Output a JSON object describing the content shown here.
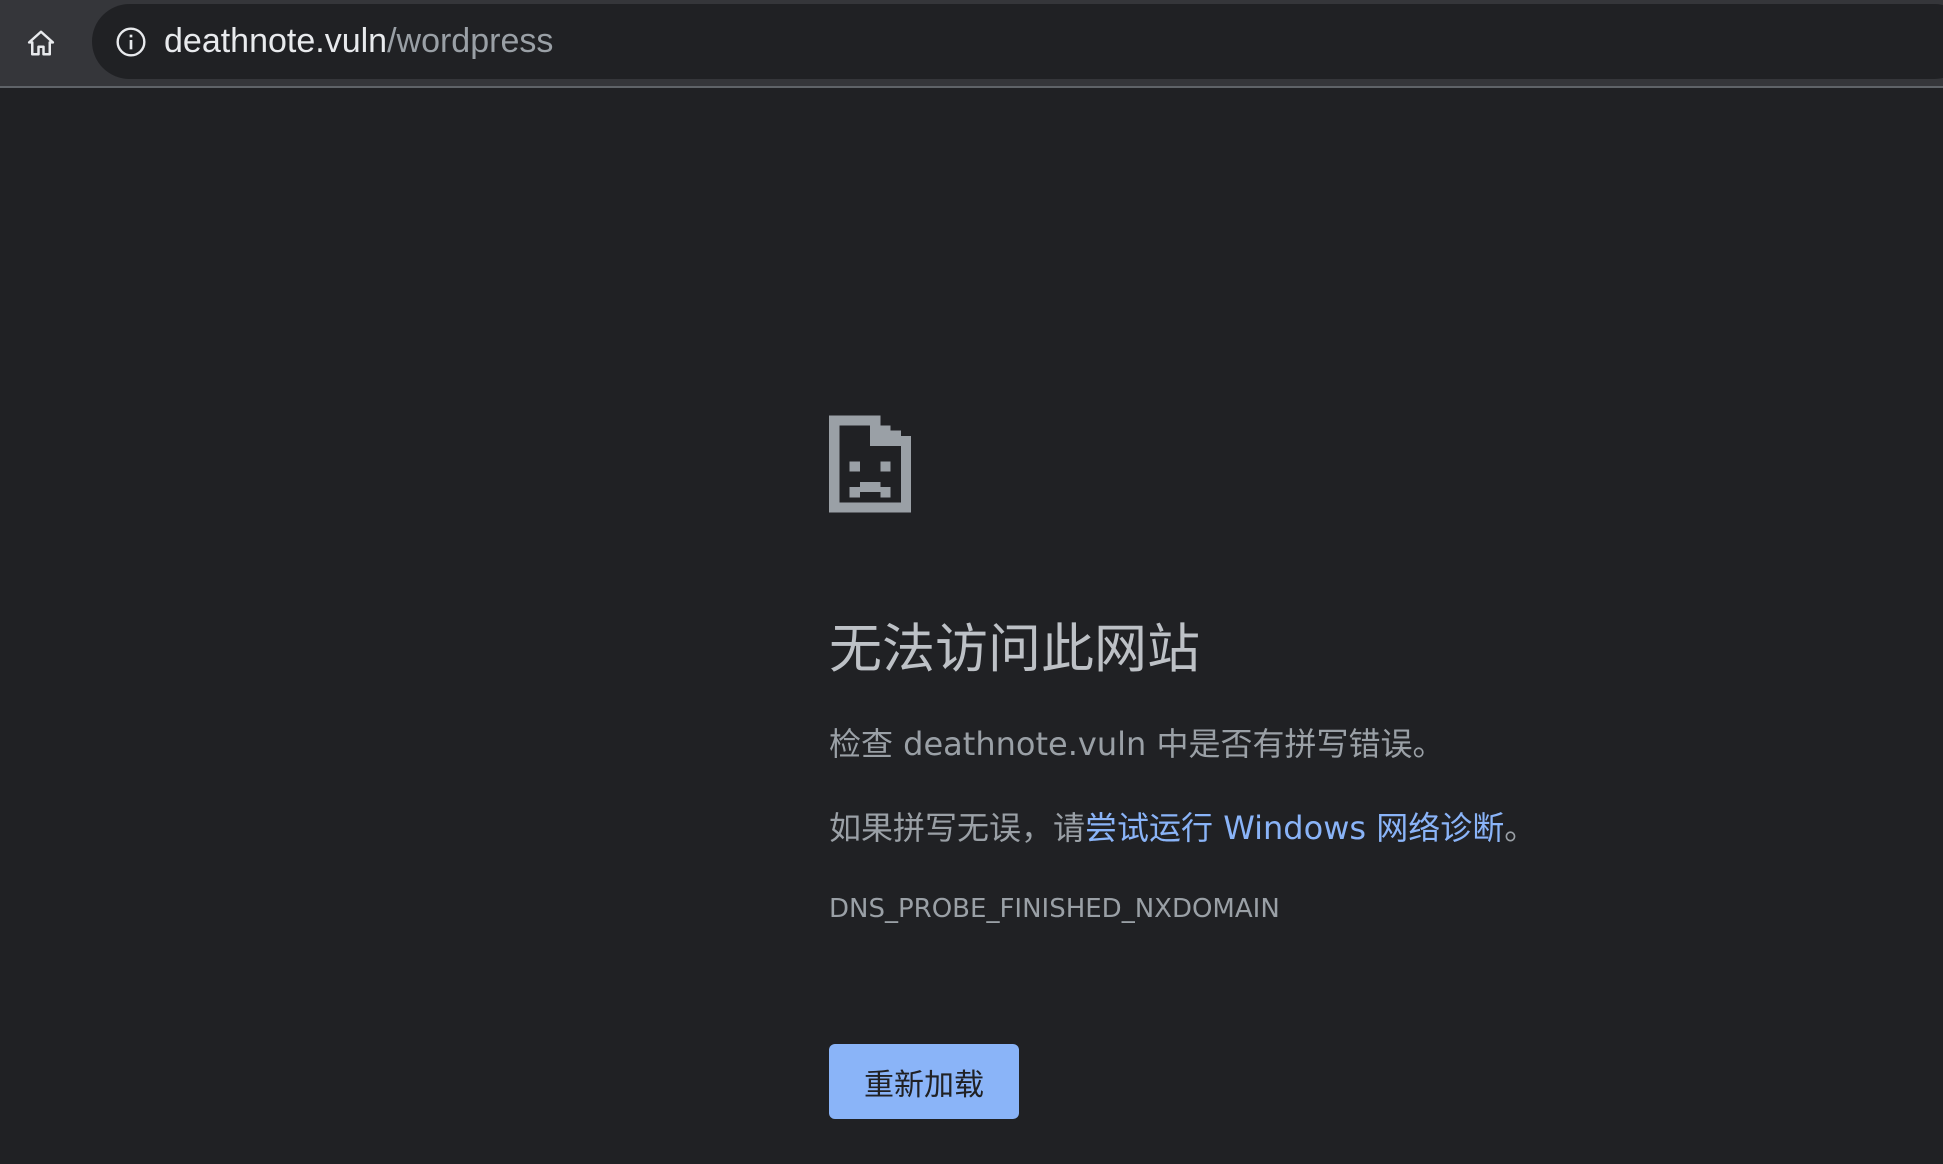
{
  "toolbar": {
    "home_icon": "home-icon",
    "info_icon": "info-icon",
    "url_host": "deathnote.vuln",
    "url_path": "/wordpress"
  },
  "error": {
    "icon": "sad-document-icon",
    "title": "无法访问此网站",
    "line1": "检查 deathnote.vuln 中是否有拼写错误。",
    "line2_prefix": "如果拼写无误，请",
    "line2_link": "尝试运行 Windows 网络诊断",
    "line2_suffix": "。",
    "code": "DNS_PROBE_FINISHED_NXDOMAIN",
    "reload_label": "重新加载"
  },
  "colors": {
    "page_background": "#202124",
    "toolbar_background": "#35363a",
    "link": "#8ab4f8",
    "button_background": "#8ab4f8"
  }
}
